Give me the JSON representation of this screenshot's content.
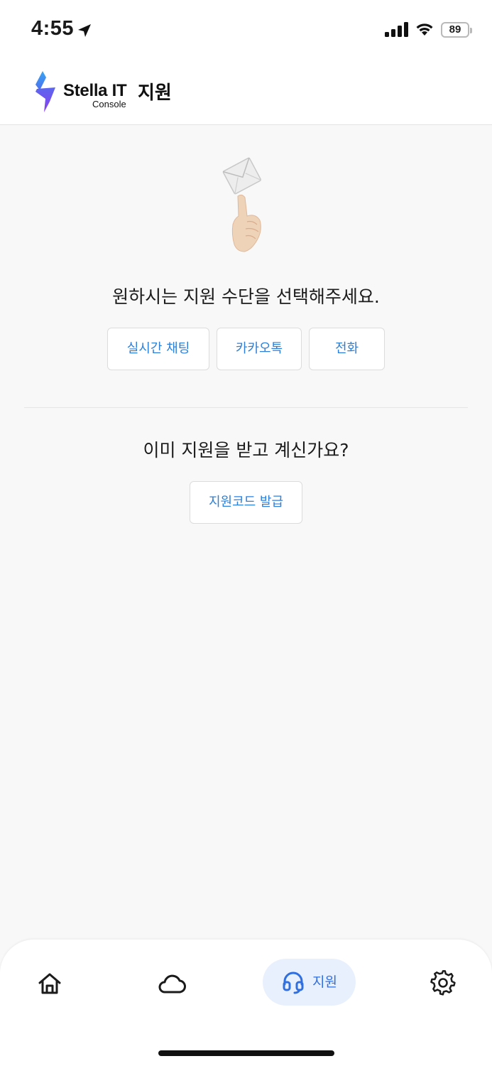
{
  "status_bar": {
    "time": "4:55",
    "battery": "89"
  },
  "header": {
    "brand_name": "Stella IT",
    "brand_sub": "Console",
    "page_title": "지원"
  },
  "support": {
    "prompt": "원하시는 지원 수단을 선택해주세요.",
    "options": [
      "실시간 채팅",
      "카카오톡",
      "전화"
    ]
  },
  "already": {
    "question": "이미 지원을 받고 계신가요?",
    "issue_code_label": "지원코드 발급"
  },
  "nav": {
    "items": [
      "home-icon",
      "cloud-icon",
      "headset-icon",
      "gear-icon"
    ],
    "active_label": "지원",
    "active_color": "#2f6fe0",
    "active_bg": "#e9f0fd"
  },
  "colors": {
    "link": "#2d7fd8"
  }
}
